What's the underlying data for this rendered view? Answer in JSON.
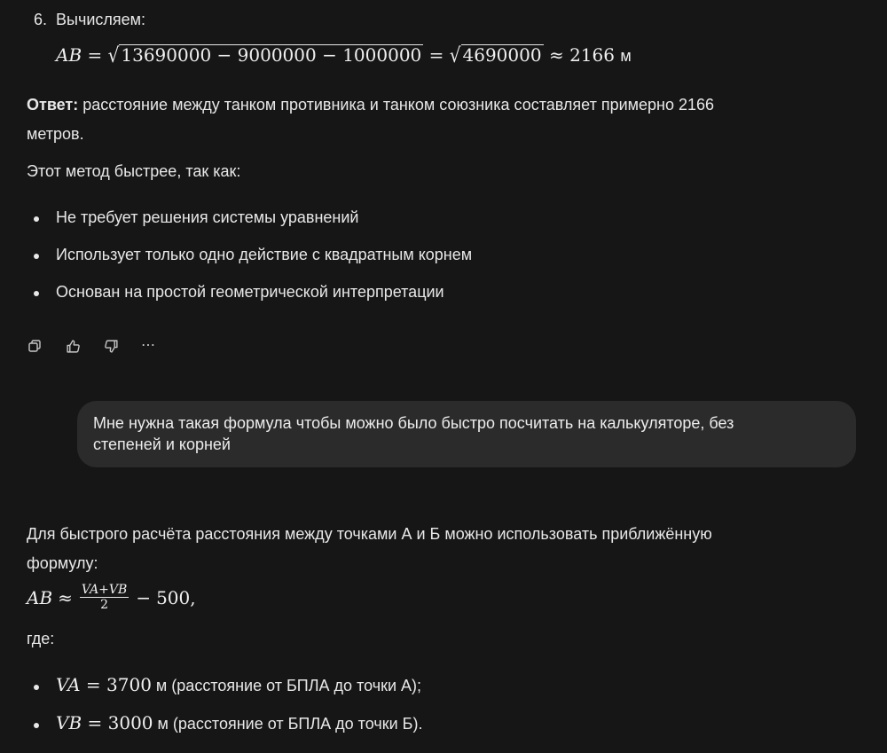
{
  "step": {
    "number": "6.",
    "text": "Вычисляем:"
  },
  "formula1": {
    "lhs": "AB",
    "eq1": "=",
    "radicand1": "13690000 − 9000000 − 1000000",
    "eq2": "=",
    "radicand2": "4690000",
    "approx": "≈",
    "result": "2166",
    "unit": "м"
  },
  "answer": {
    "label": "Ответ:",
    "text_line1": " расстояние между танком противника и танком союзника составляет примерно 2166",
    "text_line2": "метров."
  },
  "method_intro": "Этот метод быстрее, так как:",
  "reasons": [
    "Не требует решения системы уравнений",
    "Использует только одно действие с квадратным корнем",
    "Основан на простой геометрической интерпретации"
  ],
  "actions": {
    "copy": "copy-icon",
    "like": "thumbs-up-icon",
    "dislike": "thumbs-down-icon",
    "more": "⋯"
  },
  "user_message": {
    "line1": "Мне нужна такая формула чтобы можно было быстро посчитать на калькуляторе, без",
    "line2": "степеней и корней"
  },
  "reply": {
    "intro_line1": "Для быстрого расчёта расстояния между точками А и Б можно использовать приближённую",
    "intro_line2": "формулу:",
    "formula": {
      "lhs": "AB",
      "approx": "≈",
      "numerator": "VA+VB",
      "denominator": "2",
      "minus": "−",
      "constant": "500,"
    },
    "where": "где:",
    "vars": [
      {
        "name": "VA",
        "eq": "=",
        "value": "3700",
        "desc": " м (расстояние от БПЛА до точки А);"
      },
      {
        "name": "VB",
        "eq": "=",
        "value": "3000",
        "desc": " м (расстояние от БПЛА до точки Б)."
      }
    ]
  }
}
